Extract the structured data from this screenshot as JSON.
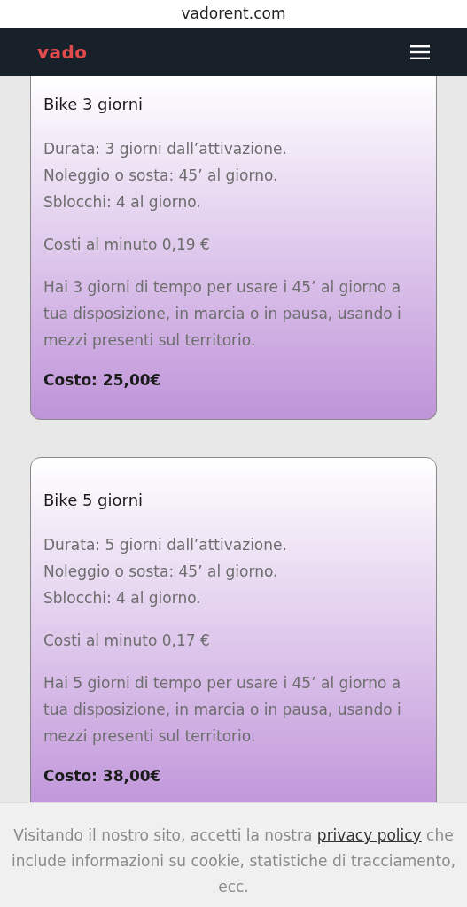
{
  "browser": {
    "address": "vadorent.com"
  },
  "navbar": {
    "logo": "vado"
  },
  "cards": [
    {
      "title": "Bike 3 giorni",
      "cut_top": true,
      "details": [
        "Durata: 3 giorni dall’attivazione.",
        "Noleggio o sosta: 45’ al giorno.",
        "Sblocchi: 4 al giorno."
      ],
      "minute_cost": "Costi al minuto 0,19 €",
      "description": "Hai 3 giorni di tempo per usare i 45’ al giorno a tua disposizione, in marcia o in pausa, usando i mezzi presenti sul territorio.",
      "price": "Costo: 25,00€"
    },
    {
      "title": "Bike 5 giorni",
      "cut_top": false,
      "details": [
        "Durata: 5 giorni dall’attivazione.",
        "Noleggio o sosta: 45’ al giorno.",
        "Sblocchi: 4 al giorno."
      ],
      "minute_cost": "Costi al minuto 0,17 €",
      "description": "Hai 5 giorni di tempo per usare i 45’ al giorno a tua disposizione, in marcia o in pausa, usando i mezzi presenti sul territorio.",
      "price": "Costo: 38,00€"
    }
  ],
  "cookie_banner": {
    "text_before": "Visitando il nostro sito, accetti la nostra",
    "link": "privacy policy",
    "text_after": "che include informazioni su cookie, statistiche di tracciamento, ecc."
  }
}
